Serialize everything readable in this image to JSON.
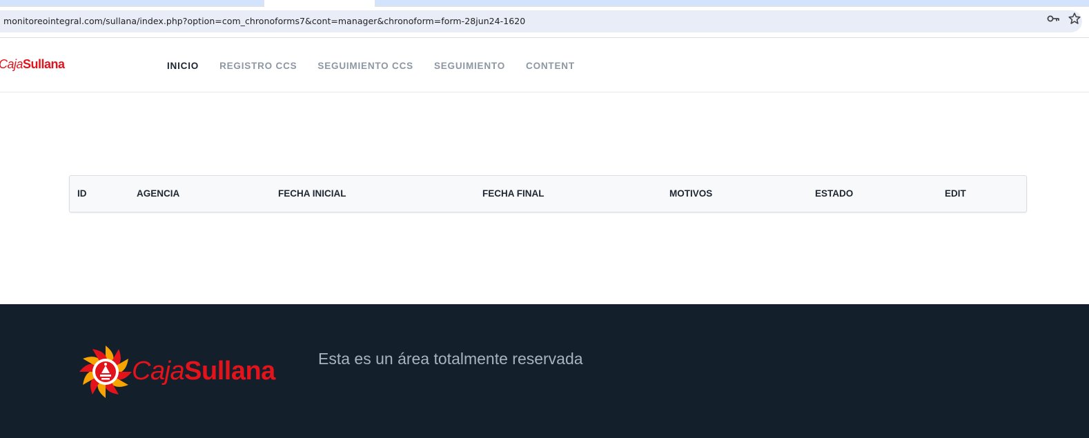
{
  "browser": {
    "url": "monitoreointegral.com/sullana/index.php?option=com_chronoforms7&cont=manager&chronoform=form-28jun24-1620",
    "icons": [
      "key-icon",
      "star-icon"
    ]
  },
  "header": {
    "logo": {
      "caja": "Caja",
      "sullana": "Sullana"
    },
    "nav": [
      {
        "label": "INICIO",
        "active": true
      },
      {
        "label": "REGISTRO CCS",
        "active": false
      },
      {
        "label": "SEGUIMIENTO CCS",
        "active": false
      },
      {
        "label": "SEGUIMIENTO",
        "active": false
      },
      {
        "label": "CONTENT",
        "active": false
      }
    ]
  },
  "table": {
    "columns": [
      "ID",
      "AGENCIA",
      "FECHA INICIAL",
      "FECHA FINAL",
      "MOTIVOS",
      "ESTADO",
      "EDIT"
    ],
    "rows": []
  },
  "footer": {
    "logo": {
      "caja": "Caja",
      "sullana": "Sullana"
    },
    "text": "Esta es un área totalmente reservada"
  },
  "colors": {
    "brand_red": "#e3131b",
    "footer_bg": "#131f2b",
    "nav_active": "#1b2530",
    "nav_inactive": "#8c97a3"
  }
}
